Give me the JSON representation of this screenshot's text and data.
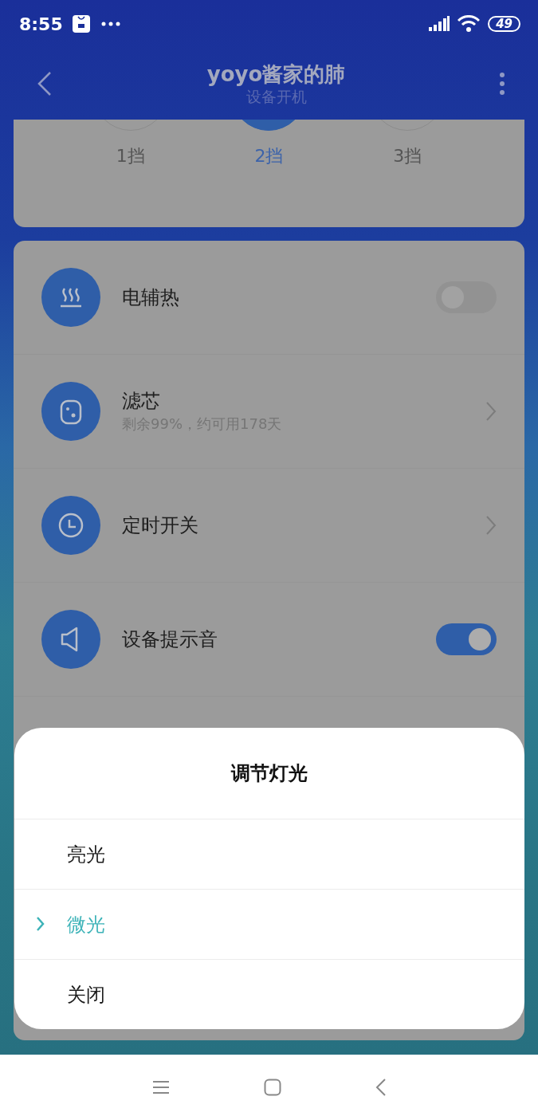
{
  "status_bar": {
    "time": "8:55",
    "battery": "49"
  },
  "header": {
    "title": "yoyo酱家的肺",
    "subtitle": "设备开机"
  },
  "gears": [
    {
      "label": "1挡",
      "selected": false
    },
    {
      "label": "2挡",
      "selected": true
    },
    {
      "label": "3挡",
      "selected": false
    }
  ],
  "settings": [
    {
      "kind": "toggle",
      "label": "电辅热",
      "on": false
    },
    {
      "kind": "link",
      "label": "滤芯",
      "detail": "剩余99%，约可用178天"
    },
    {
      "kind": "link",
      "label": "定时开关"
    },
    {
      "kind": "toggle",
      "label": "设备提示音",
      "on": true
    }
  ],
  "dialog": {
    "title": "调节灯光",
    "options": [
      {
        "label": "亮光",
        "selected": false
      },
      {
        "label": "微光",
        "selected": true
      },
      {
        "label": "关闭",
        "selected": false
      }
    ]
  }
}
